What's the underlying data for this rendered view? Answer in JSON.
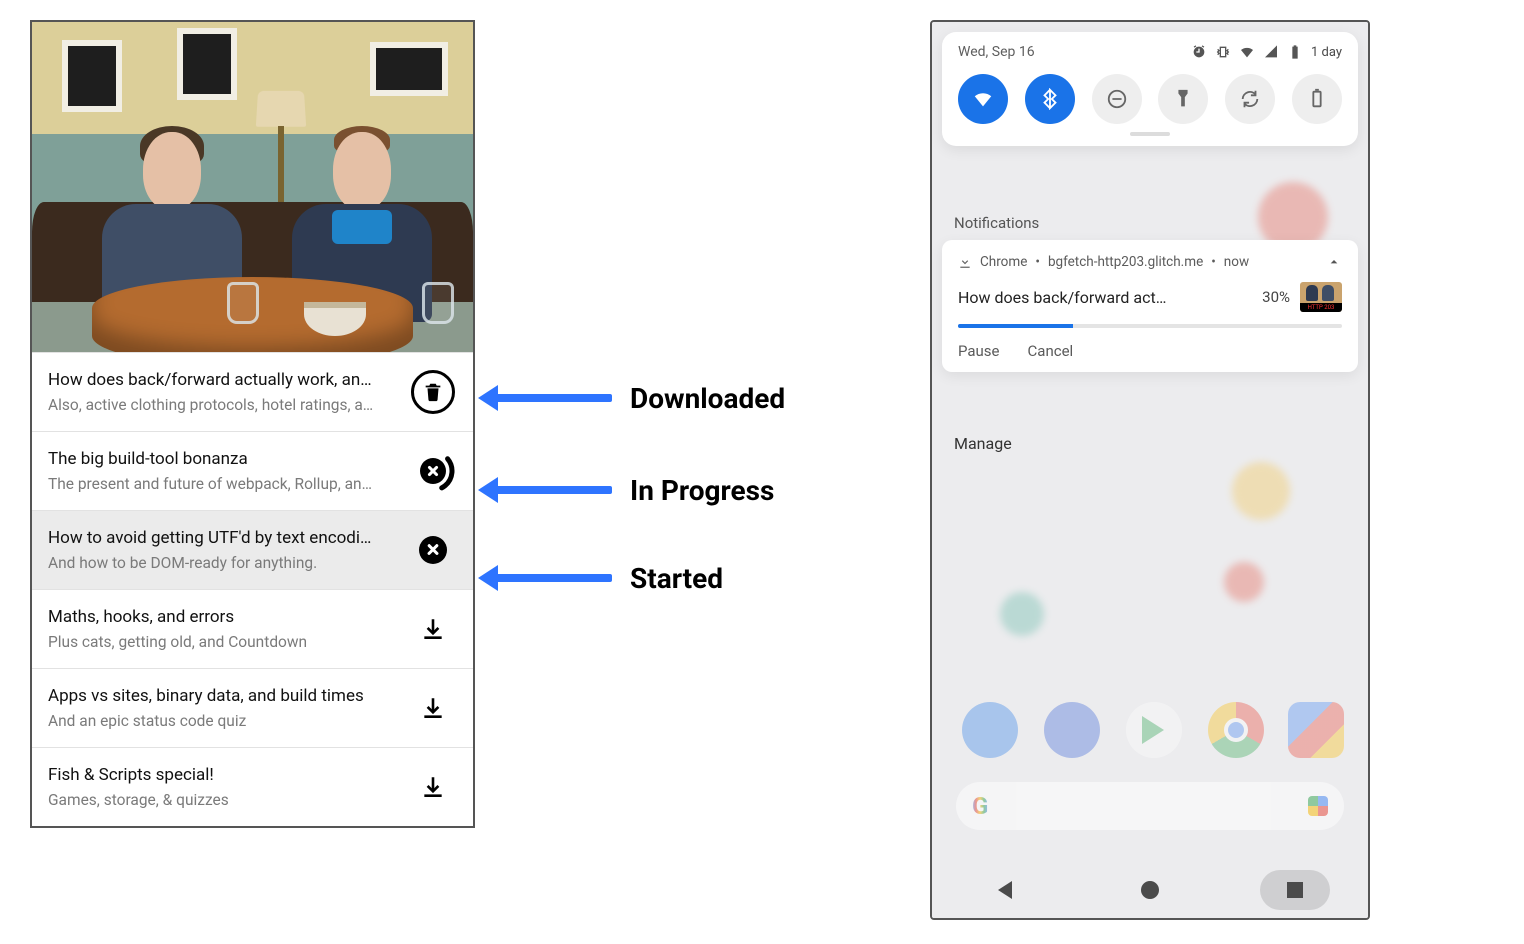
{
  "annotations": {
    "downloaded": "Downloaded",
    "in_progress": "In Progress",
    "started": "Started"
  },
  "episodes": [
    {
      "title": "How does back/forward actually work, an…",
      "subtitle": "Also, active clothing protocols, hotel ratings, a…",
      "state": "downloaded",
      "highlight": false
    },
    {
      "title": "The big build-tool bonanza",
      "subtitle": "The present and future of webpack, Rollup, an…",
      "state": "in_progress",
      "highlight": false
    },
    {
      "title": "How to avoid getting UTF'd by text encodi…",
      "subtitle": "And how to be DOM-ready for anything.",
      "state": "started",
      "highlight": true
    },
    {
      "title": "Maths, hooks, and errors",
      "subtitle": "Plus cats, getting old, and Countdown",
      "state": "download",
      "highlight": false
    },
    {
      "title": "Apps vs sites, binary data, and build times",
      "subtitle": "And an epic status code quiz",
      "state": "download",
      "highlight": false
    },
    {
      "title": "Fish & Scripts special!",
      "subtitle": "Games, storage, & quizzes",
      "state": "download",
      "highlight": false
    }
  ],
  "android": {
    "date": "Wed, Sep 16",
    "battery_text": "1 day",
    "section_notifications": "Notifications",
    "manage": "Manage",
    "notification": {
      "app": "Chrome",
      "source": "bgfetch-http203.glitch.me",
      "when": "now",
      "title": "How does back/forward act…",
      "percent_text": "30%",
      "percent_value": 30,
      "action_pause": "Pause",
      "action_cancel": "Cancel"
    }
  }
}
